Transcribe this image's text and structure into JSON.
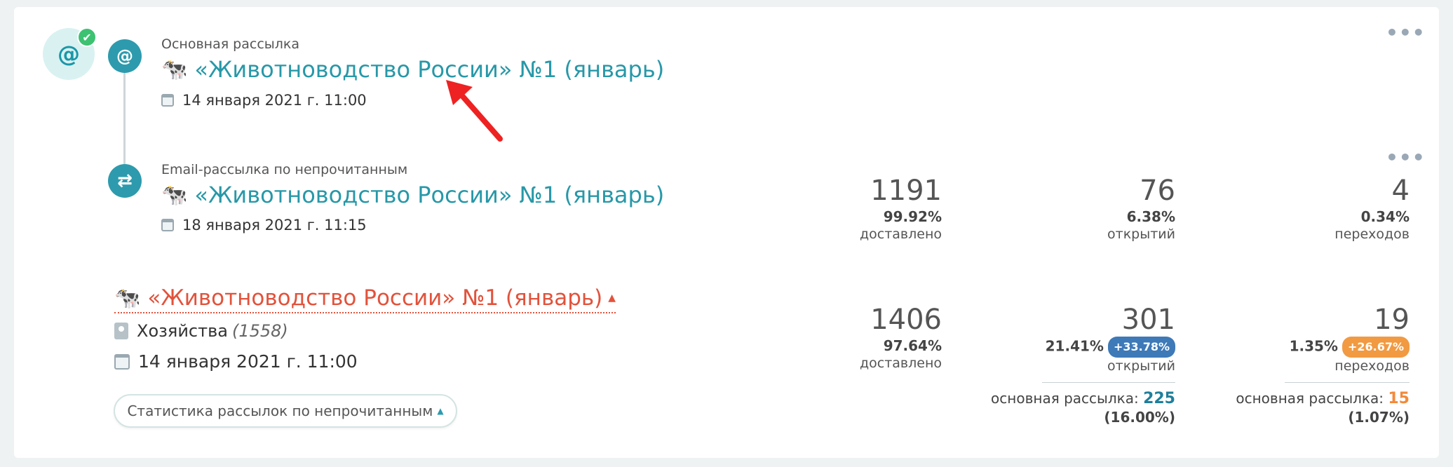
{
  "main_mailing": {
    "label": "Основная рассылка",
    "emoji": "🐄",
    "title": "«Животноводство России» №1 (январь)",
    "date": "14 января 2021 г. 11:00"
  },
  "unread_mailing": {
    "label": "Email-рассылка по непрочитанным",
    "emoji": "🐄",
    "title": "«Животноводство России» №1 (январь)",
    "date": "18 января 2021 г. 11:15",
    "stats": {
      "delivered": {
        "num": "1191",
        "pct": "99.92%",
        "label": "доставлено"
      },
      "opened": {
        "num": "76",
        "pct": "6.38%",
        "label": "открытий"
      },
      "clicks": {
        "num": "4",
        "pct": "0.34%",
        "label": "переходов"
      }
    }
  },
  "summary": {
    "emoji": "🐄",
    "title": "«Животноводство России» №1 (январь)",
    "audience": "Хозяйства",
    "audience_count": "(1558)",
    "date": "14 января 2021 г. 11:00",
    "stats_button": "Статистика рассылок по непрочитанным",
    "stats": {
      "delivered": {
        "num": "1406",
        "pct": "97.64%",
        "label": "доставлено"
      },
      "opened": {
        "num": "301",
        "pct": "21.41%",
        "badge": "+33.78%",
        "label": "открытий",
        "main_label": "основная рассылка:",
        "main_value": "225",
        "main_pct": "(16.00%)"
      },
      "clicks": {
        "num": "19",
        "pct": "1.35%",
        "badge": "+26.67%",
        "label": "переходов",
        "main_label": "основная рассылка:",
        "main_value": "15",
        "main_pct": "(1.07%)"
      }
    }
  },
  "icons": {
    "at": "@",
    "check": "✔",
    "repeat": "⇄",
    "more": "•••",
    "caret_up": "▲"
  },
  "colors": {
    "accent": "#2798a8",
    "red": "#e2523b",
    "green": "#3cc271",
    "badge_blue": "#3e79b8",
    "badge_orange": "#f19a42"
  }
}
